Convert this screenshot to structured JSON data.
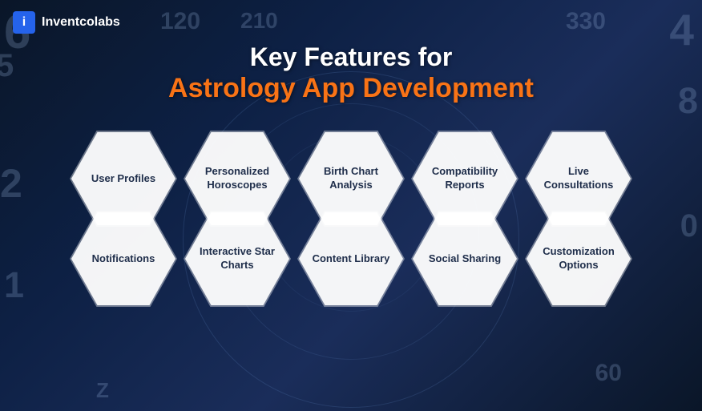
{
  "brand": {
    "logo_letter": "i",
    "logo_name": "Inventcolabs"
  },
  "header": {
    "line1": "Key Features for",
    "line2": "Astrology App Development"
  },
  "row1": [
    {
      "label": "User Profiles"
    },
    {
      "label": "Personalized\nHoroscopes"
    },
    {
      "label": "Birth Chart\nAnalysis"
    },
    {
      "label": "Compatibility\nReports"
    },
    {
      "label": "Live\nConsultations"
    }
  ],
  "row2": [
    {
      "label": "Notifications"
    },
    {
      "label": "Interactive\nStar Charts"
    },
    {
      "label": "Content\nLibrary"
    },
    {
      "label": "Social Sharing"
    },
    {
      "label": "Customization\nOptions"
    }
  ]
}
